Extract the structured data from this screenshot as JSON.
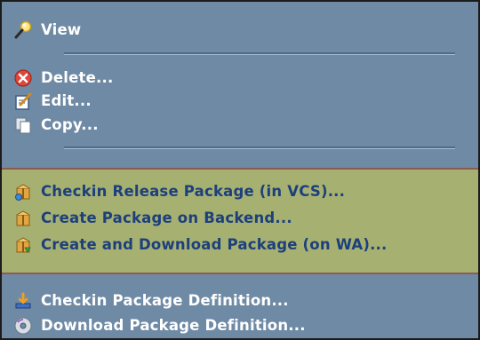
{
  "menu": {
    "items": [
      {
        "label": "View",
        "icon": "magnifier-icon"
      },
      {
        "label": "Delete...",
        "icon": "delete-icon"
      },
      {
        "label": "Edit...",
        "icon": "edit-icon"
      },
      {
        "label": "Copy...",
        "icon": "copy-icon"
      },
      {
        "label": "Checkin Release Package (in VCS)...",
        "icon": "package-checkin-icon"
      },
      {
        "label": "Create Package on Backend...",
        "icon": "package-create-icon"
      },
      {
        "label": "Create and Download Package (on WA)...",
        "icon": "package-download-icon"
      },
      {
        "label": "Checkin Package Definition...",
        "icon": "checkin-definition-icon"
      },
      {
        "label": "Download Package Definition...",
        "icon": "download-definition-icon"
      }
    ]
  },
  "colors": {
    "menu_background": "#6f8aa5",
    "highlight_background": "#a6b171",
    "highlight_border": "#8d5a50",
    "highlight_text": "#1d3f7c",
    "normal_text": "#ffffff"
  }
}
